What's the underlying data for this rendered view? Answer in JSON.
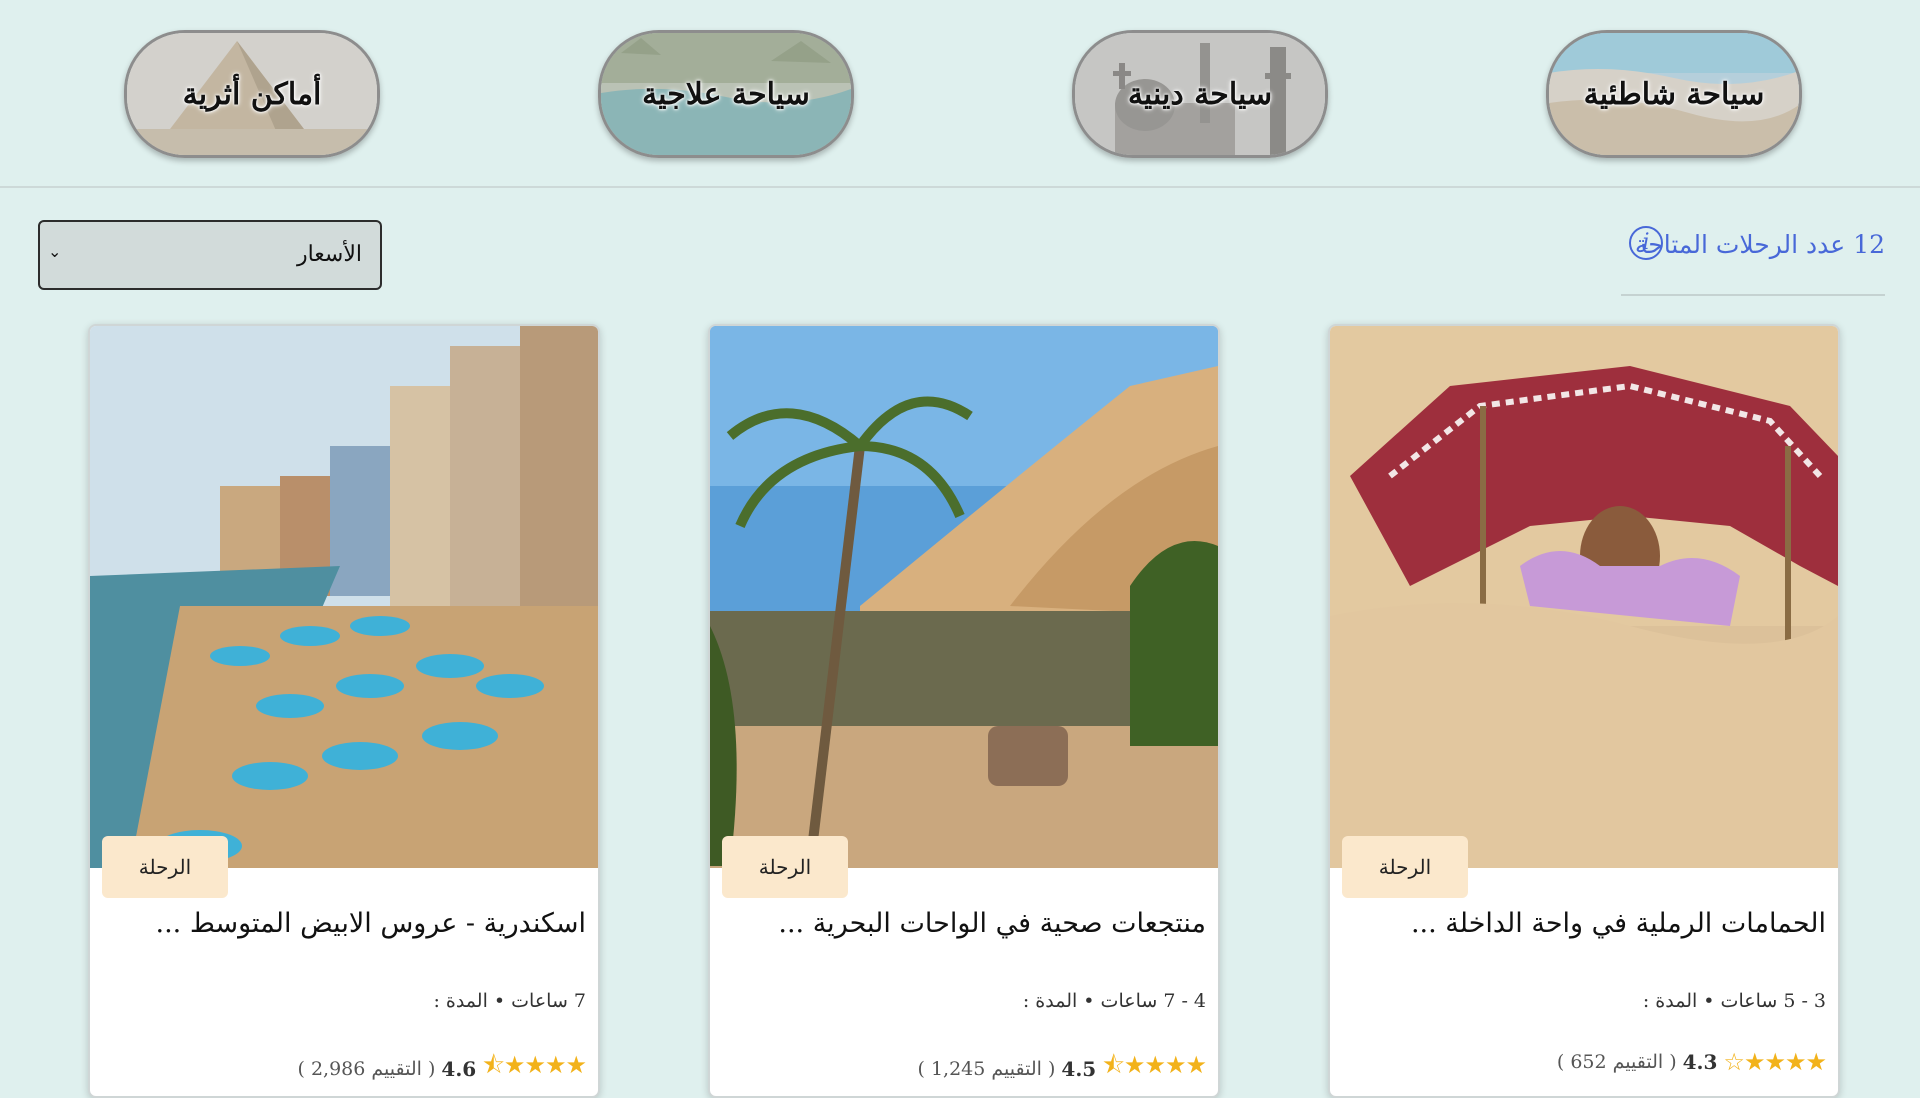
{
  "categories": [
    {
      "label": "سياحة شاطئية",
      "icon": "beach-photo"
    },
    {
      "label": "سياحة دينية",
      "icon": "mosque-church-photo"
    },
    {
      "label": "سياحة علاجية",
      "icon": "hot-spring-photo"
    },
    {
      "label": "أماكن أثرية",
      "icon": "pyramids-photo"
    }
  ],
  "trips_count": {
    "number": "12",
    "label": "عدد الرحلات المتاحة",
    "icon": "info-icon"
  },
  "sort": {
    "selected": "الأسعار",
    "icon": "chevron-down-icon"
  },
  "cards": [
    {
      "badge": "الرحلة",
      "title": "الحمامات الرملية في واحة الداخلة ...",
      "duration": "3 - 5 ساعات • المدة :",
      "rating": "4.3",
      "stars": "★★★★☆",
      "reviews": "( التقييم 652 )",
      "image": "sand-bath-photo"
    },
    {
      "badge": "الرحلة",
      "title": "منتجعات صحية في الواحات البحرية ...",
      "duration": "4 - 7 ساعات • المدة :",
      "rating": "4.5",
      "stars": "★★★★⯪",
      "reviews": "( التقييم 1,245 )",
      "image": "oasis-photo"
    },
    {
      "badge": "الرحلة",
      "title": "اسكندرية - عروس الابيض المتوسط ...",
      "duration": "7 ساعات • المدة :",
      "rating": "4.6",
      "stars": "★★★★⯪",
      "reviews": "( التقييم 2,986 )",
      "image": "alexandria-beach-photo"
    }
  ],
  "colors": {
    "background": "#dff0ee",
    "accent": "#4868d8",
    "badge": "#fbe8cc",
    "star": "#f2b21a"
  }
}
